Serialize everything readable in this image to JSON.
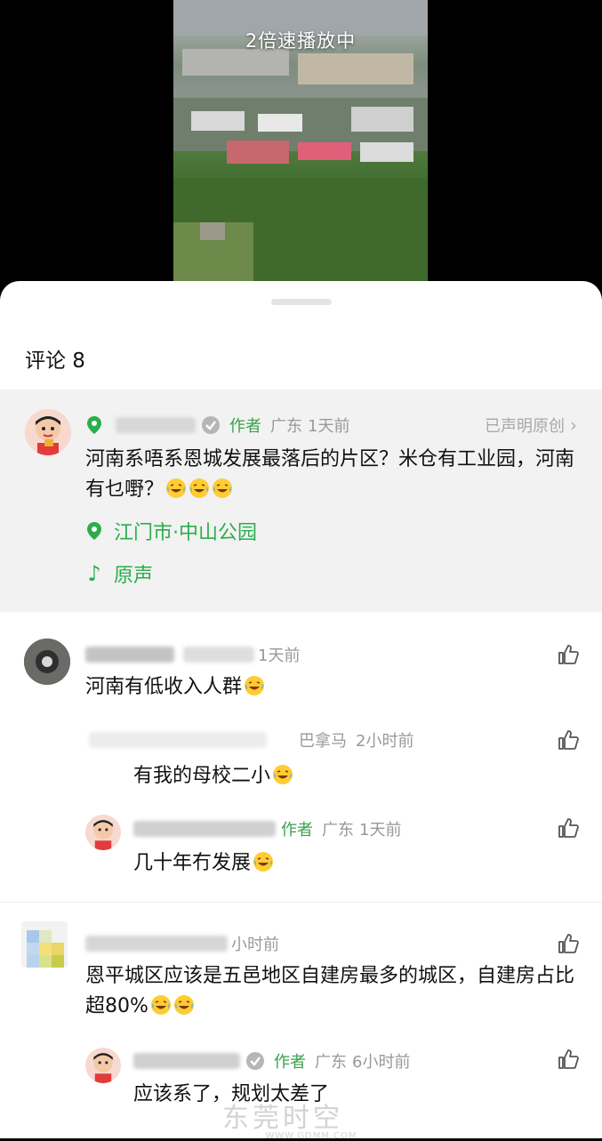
{
  "video": {
    "speed_label": "2倍速播放中"
  },
  "comments_header": {
    "title": "评论 8"
  },
  "author_post": {
    "author_badge": "作者",
    "region": "广东",
    "time": "1天前",
    "original_label": "已声明原创",
    "text": "河南系唔系恩城发展最落后的片区？米仓有工业园，河南有乜嘢？",
    "location": "江门市·中山公园",
    "music": "原声"
  },
  "comments": [
    {
      "time": "1天前",
      "text": "河南有低收入人群",
      "replies": [
        {
          "region": "巴拿马",
          "time": "2小时前",
          "text": "有我的母校二小"
        },
        {
          "author_badge": "作者",
          "region": "广东",
          "time": "1天前",
          "text": "几十年冇发展"
        }
      ]
    },
    {
      "time": "小时前",
      "text": "恩平城区应该是五邑地区自建房最多的城区，自建房占比超80%",
      "replies": [
        {
          "author_badge": "作者",
          "region": "广东",
          "time": "6小时前",
          "text": "应该系了，规划太差了"
        }
      ]
    }
  ],
  "watermark": {
    "text": "东莞时空",
    "url": "WWW.GDMM.COM"
  },
  "icons": {
    "location": "location-pin-icon",
    "music": "music-note-icon",
    "like": "thumbs-up-icon",
    "verified": "verified-check-icon",
    "emoji": "laugh-cry-emoji-icon"
  },
  "colors": {
    "accent_green": "#2aae4c",
    "meta_gray": "#999999",
    "sheet_bg": "#ffffff",
    "pinned_bg": "#f2f2f2"
  }
}
